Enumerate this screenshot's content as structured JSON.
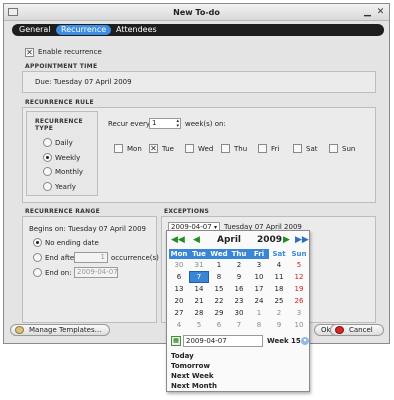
{
  "window": {
    "title": "New To-do"
  },
  "tabs": [
    {
      "label": "General",
      "active": false
    },
    {
      "label": "Recurrence",
      "active": true
    },
    {
      "label": "Attendees",
      "active": false
    }
  ],
  "enable_recurrence": {
    "label": "Enable recurrence",
    "checked": true
  },
  "appointment_time": {
    "title": "APPOINTMENT TIME",
    "due": "Due: Tuesday 07 April 2009"
  },
  "recurrence_rule": {
    "title": "RECURRENCE RULE",
    "types_title": "RECURRENCE TYPE",
    "types": [
      {
        "label": "Daily",
        "selected": false
      },
      {
        "label": "Weekly",
        "selected": true
      },
      {
        "label": "Monthly",
        "selected": false
      },
      {
        "label": "Yearly",
        "selected": false
      }
    ],
    "recur_prefix": "Recur every",
    "recur_value": "1",
    "recur_suffix": "week(s) on:",
    "days": [
      {
        "label": "Mon",
        "checked": false
      },
      {
        "label": "Tue",
        "checked": true
      },
      {
        "label": "Wed",
        "checked": false
      },
      {
        "label": "Thu",
        "checked": false
      },
      {
        "label": "Fri",
        "checked": false
      },
      {
        "label": "Sat",
        "checked": false
      },
      {
        "label": "Sun",
        "checked": false
      }
    ]
  },
  "recurrence_range": {
    "title": "RECURRENCE RANGE",
    "begins_on": "Begins on: Tuesday 07 April 2009",
    "no_ending": "No ending date",
    "end_after": "End after",
    "end_after_value": "1",
    "occurrences": "occurrence(s)",
    "end_on": "End on:",
    "end_on_value": "2009-04-07"
  },
  "exceptions": {
    "title": "EXCEPTIONS",
    "date_value": "2009-04-07",
    "date_label": "Tuesday 07 April 2009"
  },
  "buttons": {
    "manage_templates": "Manage Templates...",
    "ok": "Ok",
    "cancel": "Cancel"
  },
  "calendar": {
    "month": "April",
    "year": "2009",
    "weekdays": [
      "Mon",
      "Tue",
      "Wed",
      "Thu",
      "Fri",
      "Sat",
      "Sun"
    ],
    "weeks": [
      [
        "30",
        "31",
        "1",
        "2",
        "3",
        "4",
        "5"
      ],
      [
        "6",
        "7",
        "8",
        "9",
        "10",
        "11",
        "12"
      ],
      [
        "13",
        "14",
        "15",
        "16",
        "17",
        "18",
        "19"
      ],
      [
        "20",
        "21",
        "22",
        "23",
        "24",
        "25",
        "26"
      ],
      [
        "27",
        "28",
        "29",
        "30",
        "1",
        "2",
        "3"
      ],
      [
        "4",
        "5",
        "6",
        "7",
        "8",
        "9",
        "10"
      ]
    ],
    "selected_day": "7",
    "date_input": "2009-04-07",
    "week_label": "Week 15",
    "quick": [
      "Today",
      "Tomorrow",
      "Next Week",
      "Next Month"
    ]
  },
  "colors": {
    "accent": "#3a86d6",
    "nav_green": "#1f8f1f",
    "nav_blue": "#2b6fc4",
    "sunday_red": "#cc2020"
  }
}
